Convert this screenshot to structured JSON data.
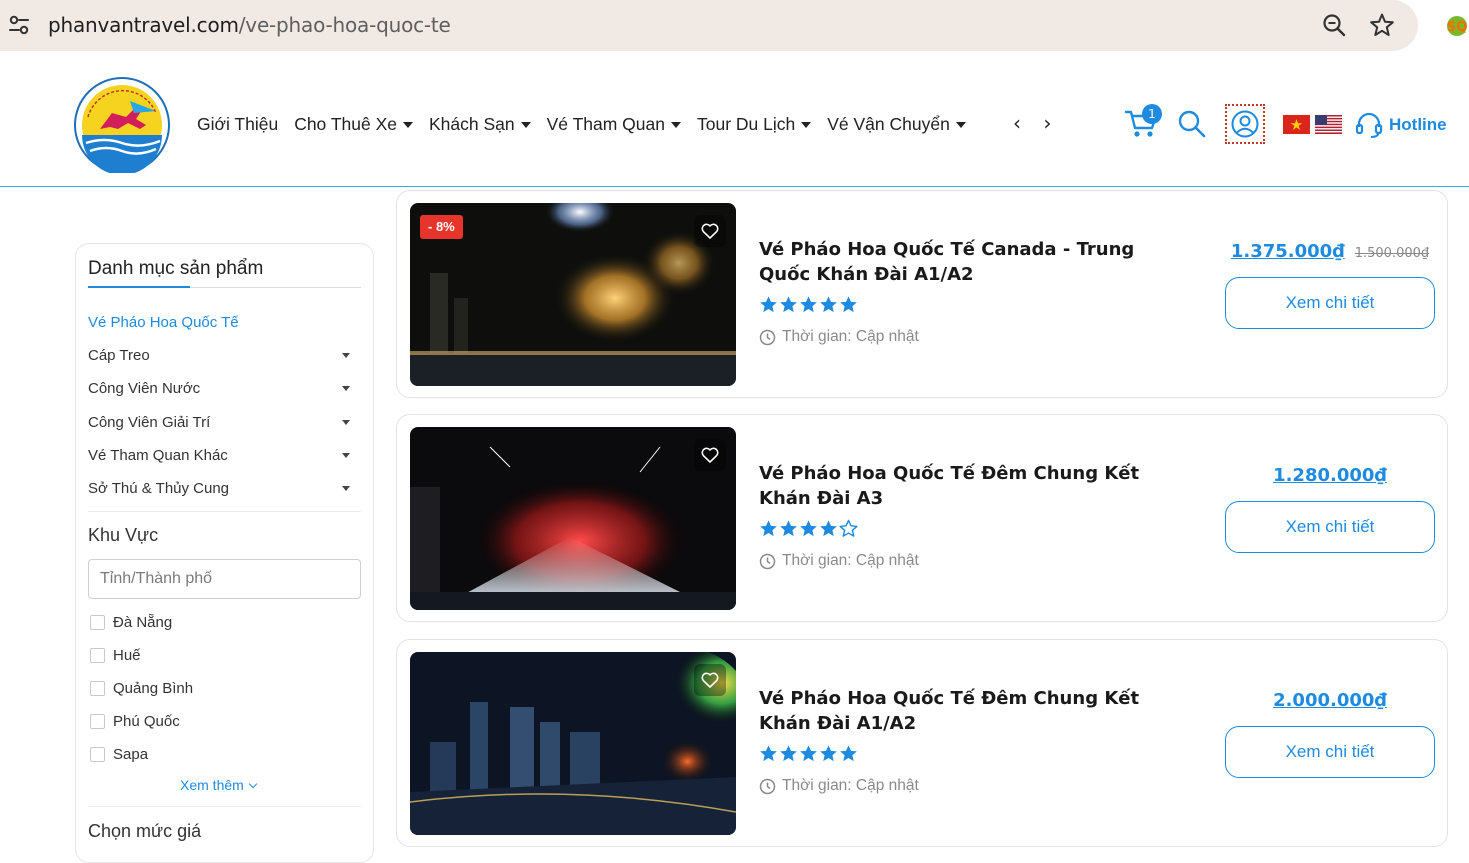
{
  "browser": {
    "url_domain": "phanvantravel.com",
    "url_path": "/ve-phao-hoa-quoc-te"
  },
  "header": {
    "logo_alt": "CÔNG TY TNHH PHAN VĂN",
    "nav": [
      {
        "label": "Giới Thiệu",
        "has_dropdown": false
      },
      {
        "label": "Cho Thuê Xe",
        "has_dropdown": true
      },
      {
        "label": "Khách Sạn",
        "has_dropdown": true
      },
      {
        "label": "Vé Tham Quan",
        "has_dropdown": true
      },
      {
        "label": "Tour Du Lịch",
        "has_dropdown": true
      },
      {
        "label": "Vé Vận Chuyển",
        "has_dropdown": true
      }
    ],
    "nav_arrows": "‹ ›",
    "cart_count": "1",
    "hotline_label": "Hotline"
  },
  "sidebar": {
    "title": "Danh mục sản phẩm",
    "categories": [
      {
        "label": "Vé Pháo Hoa Quốc Tế",
        "active": true,
        "has_dropdown": false
      },
      {
        "label": "Cáp Treo",
        "active": false,
        "has_dropdown": true
      },
      {
        "label": "Công Viên Nước",
        "active": false,
        "has_dropdown": true
      },
      {
        "label": "Công Viên Giải Trí",
        "active": false,
        "has_dropdown": true
      },
      {
        "label": "Vé Tham Quan Khác",
        "active": false,
        "has_dropdown": true
      },
      {
        "label": "Sở Thú & Thủy Cung",
        "active": false,
        "has_dropdown": true
      }
    ],
    "area_title": "Khu Vực",
    "province_placeholder": "Tỉnh/Thành phố",
    "areas": [
      "Đà Nẵng",
      "Huế",
      "Quảng Bình",
      "Phú Quốc",
      "Sapa"
    ],
    "see_more": "Xem thêm",
    "price_title": "Chọn mức giá"
  },
  "products": [
    {
      "title": "Vé Pháo Hoa Quốc Tế Canada - Trung Quốc Khán Đài A1/A2",
      "rating": 5,
      "time_label": "Thời gian: Cập nhật",
      "price": "1.375.000₫",
      "old_price": "1.500.000₫",
      "discount": "- 8%",
      "button": "Xem chi tiết"
    },
    {
      "title": "Vé Pháo Hoa Quốc Tế Đêm Chung Kết Khán Đài A3",
      "rating": 4,
      "time_label": "Thời gian: Cập nhật",
      "price": "1.280.000₫",
      "old_price": "",
      "discount": "",
      "button": "Xem chi tiết"
    },
    {
      "title": "Vé Pháo Hoa Quốc Tế Đêm Chung Kết Khán Đài A1/A2",
      "rating": 5,
      "time_label": "Thời gian: Cập nhật",
      "price": "2.000.000₫",
      "old_price": "",
      "discount": "",
      "button": "Xem chi tiết"
    }
  ],
  "colors": {
    "accent": "#1e8be0",
    "discount": "#e8352c",
    "star": "#1e8be0"
  }
}
